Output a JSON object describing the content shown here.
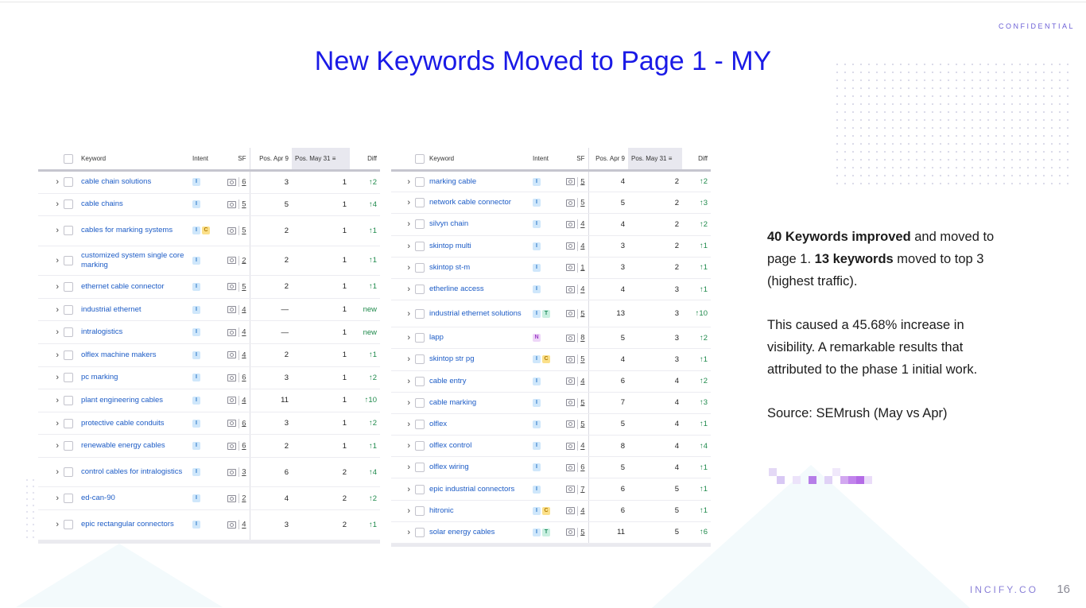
{
  "confidential": "CONFIDENTIAL",
  "title": "New Keywords Moved to Page 1 - MY",
  "headers": {
    "keyword": "Keyword",
    "intent": "Intent",
    "sf": "SF",
    "pos_a": "Pos. Apr 9",
    "pos_b": "Pos. May 31",
    "diff": "Diff"
  },
  "left_rows": [
    {
      "kw": "cable chain solutions",
      "intent": [
        "I"
      ],
      "sf": "6",
      "a": "3",
      "b": "1",
      "d": "↑2"
    },
    {
      "kw": "cable chains",
      "intent": [
        "I"
      ],
      "sf": "5",
      "a": "5",
      "b": "1",
      "d": "↑4"
    },
    {
      "kw": "cables for marking systems",
      "intent": [
        "I",
        "C"
      ],
      "sf": "5",
      "a": "2",
      "b": "1",
      "d": "↑1",
      "two": true
    },
    {
      "kw": "customized system single core marking",
      "intent": [
        "I"
      ],
      "sf": "2",
      "a": "2",
      "b": "1",
      "d": "↑1",
      "two": true
    },
    {
      "kw": "ethernet cable connector",
      "intent": [
        "I"
      ],
      "sf": "5",
      "a": "2",
      "b": "1",
      "d": "↑1"
    },
    {
      "kw": "industrial ethernet",
      "intent": [
        "I"
      ],
      "sf": "4",
      "a": "—",
      "b": "1",
      "d": "new"
    },
    {
      "kw": "intralogistics",
      "intent": [
        "I"
      ],
      "sf": "4",
      "a": "—",
      "b": "1",
      "d": "new"
    },
    {
      "kw": "olflex machine makers",
      "intent": [
        "I"
      ],
      "sf": "4",
      "a": "2",
      "b": "1",
      "d": "↑1"
    },
    {
      "kw": "pc marking",
      "intent": [
        "I"
      ],
      "sf": "6",
      "a": "3",
      "b": "1",
      "d": "↑2"
    },
    {
      "kw": "plant engineering cables",
      "intent": [
        "I"
      ],
      "sf": "4",
      "a": "11",
      "b": "1",
      "d": "↑10"
    },
    {
      "kw": "protective cable conduits",
      "intent": [
        "I"
      ],
      "sf": "6",
      "a": "3",
      "b": "1",
      "d": "↑2"
    },
    {
      "kw": "renewable energy cables",
      "intent": [
        "I"
      ],
      "sf": "6",
      "a": "2",
      "b": "1",
      "d": "↑1"
    },
    {
      "kw": "control cables for intralogistics",
      "intent": [
        "I"
      ],
      "sf": "3",
      "a": "6",
      "b": "2",
      "d": "↑4",
      "two": true
    },
    {
      "kw": "ed-can-90",
      "intent": [
        "I"
      ],
      "sf": "2",
      "a": "4",
      "b": "2",
      "d": "↑2"
    },
    {
      "kw": "epic rectangular connectors",
      "intent": [
        "I"
      ],
      "sf": "4",
      "a": "3",
      "b": "2",
      "d": "↑1",
      "two": true
    }
  ],
  "right_rows": [
    {
      "kw": "marking cable",
      "intent": [
        "I"
      ],
      "sf": "5",
      "a": "4",
      "b": "2",
      "d": "↑2"
    },
    {
      "kw": "network cable connector",
      "intent": [
        "I"
      ],
      "sf": "5",
      "a": "5",
      "b": "2",
      "d": "↑3"
    },
    {
      "kw": "silvyn chain",
      "intent": [
        "I"
      ],
      "sf": "4",
      "a": "4",
      "b": "2",
      "d": "↑2"
    },
    {
      "kw": "skintop multi",
      "intent": [
        "I"
      ],
      "sf": "4",
      "a": "3",
      "b": "2",
      "d": "↑1"
    },
    {
      "kw": "skintop st-m",
      "intent": [
        "I"
      ],
      "sf": "1",
      "a": "3",
      "b": "2",
      "d": "↑1"
    },
    {
      "kw": "etherline access",
      "intent": [
        "I"
      ],
      "sf": "4",
      "a": "4",
      "b": "3",
      "d": "↑1"
    },
    {
      "kw": "industrial ethernet solutions",
      "intent": [
        "I",
        "T"
      ],
      "sf": "5",
      "a": "13",
      "b": "3",
      "d": "↑10",
      "two": true
    },
    {
      "kw": "lapp",
      "intent": [
        "N"
      ],
      "sf": "8",
      "a": "5",
      "b": "3",
      "d": "↑2"
    },
    {
      "kw": "skintop str pg",
      "intent": [
        "I",
        "C"
      ],
      "sf": "5",
      "a": "4",
      "b": "3",
      "d": "↑1"
    },
    {
      "kw": "cable entry",
      "intent": [
        "I"
      ],
      "sf": "4",
      "a": "6",
      "b": "4",
      "d": "↑2"
    },
    {
      "kw": "cable marking",
      "intent": [
        "I"
      ],
      "sf": "5",
      "a": "7",
      "b": "4",
      "d": "↑3"
    },
    {
      "kw": "olflex",
      "intent": [
        "I"
      ],
      "sf": "5",
      "a": "5",
      "b": "4",
      "d": "↑1"
    },
    {
      "kw": "olflex control",
      "intent": [
        "I"
      ],
      "sf": "4",
      "a": "8",
      "b": "4",
      "d": "↑4"
    },
    {
      "kw": "olflex wiring",
      "intent": [
        "I"
      ],
      "sf": "6",
      "a": "5",
      "b": "4",
      "d": "↑1"
    },
    {
      "kw": "epic industrial connectors",
      "intent": [
        "I"
      ],
      "sf": "7",
      "a": "6",
      "b": "5",
      "d": "↑1"
    },
    {
      "kw": "hitronic",
      "intent": [
        "I",
        "C"
      ],
      "sf": "4",
      "a": "6",
      "b": "5",
      "d": "↑1"
    },
    {
      "kw": "solar energy cables",
      "intent": [
        "I",
        "T"
      ],
      "sf": "5",
      "a": "11",
      "b": "5",
      "d": "↑6"
    }
  ],
  "summary": {
    "p1_b1": "40 Keywords improved",
    "p1_t1": " and moved to page 1. ",
    "p1_b2": "13 keywords",
    "p1_t2": " moved to top 3 (highest traffic).",
    "p2": "This caused a 45.68% increase in visibility. A remarkable results that attributed to the phase 1 initial work.",
    "p3": "Source: SEMrush (May vs Apr)"
  },
  "brand": "INCIFY.CO",
  "page_number": "16",
  "colors": {
    "title": "#1a1ae6",
    "keyword_link": "#1d5cc6",
    "diff_up": "#1f8a4c",
    "brand": "#8a80d8"
  }
}
